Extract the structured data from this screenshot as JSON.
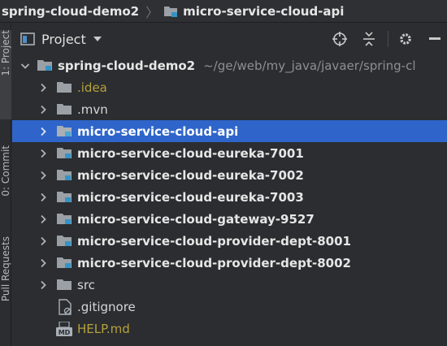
{
  "breadcrumb": {
    "items": [
      "spring-cloud-demo2",
      "micro-service-cloud-api"
    ],
    "separator": "〉"
  },
  "tool_strip": {
    "tabs": [
      "1: Project",
      "0: Commit",
      "Pull Requests"
    ]
  },
  "panel": {
    "title": "Project"
  },
  "tree": {
    "root": {
      "name": "spring-cloud-demo2",
      "path": "~/ge/web/my_java/javaer/spring-cl"
    },
    "items": [
      {
        "name": ".idea",
        "style": "ignored",
        "type": "folder"
      },
      {
        "name": ".mvn",
        "style": "plain",
        "type": "folder"
      },
      {
        "name": "micro-service-cloud-api",
        "style": "bold",
        "type": "module",
        "selected": true
      },
      {
        "name": "micro-service-cloud-eureka-7001",
        "style": "bold",
        "type": "module"
      },
      {
        "name": "micro-service-cloud-eureka-7002",
        "style": "bold",
        "type": "module"
      },
      {
        "name": "micro-service-cloud-eureka-7003",
        "style": "bold",
        "type": "module"
      },
      {
        "name": "micro-service-cloud-gateway-9527",
        "style": "bold",
        "type": "module"
      },
      {
        "name": "micro-service-cloud-provider-dept-8001",
        "style": "bold",
        "type": "module"
      },
      {
        "name": "micro-service-cloud-provider-dept-8002",
        "style": "bold",
        "type": "module"
      },
      {
        "name": "src",
        "style": "plain",
        "type": "folder"
      },
      {
        "name": ".gitignore",
        "style": "plain",
        "type": "file-ignore"
      },
      {
        "name": "HELP.md",
        "style": "ignored",
        "type": "file-md"
      }
    ]
  },
  "colors": {
    "background": "#2b2d30",
    "selection": "#2f65ca",
    "module_badge": "#3592c4",
    "ignored_text": "#b5a23a",
    "folder": "#9aa0a6"
  }
}
